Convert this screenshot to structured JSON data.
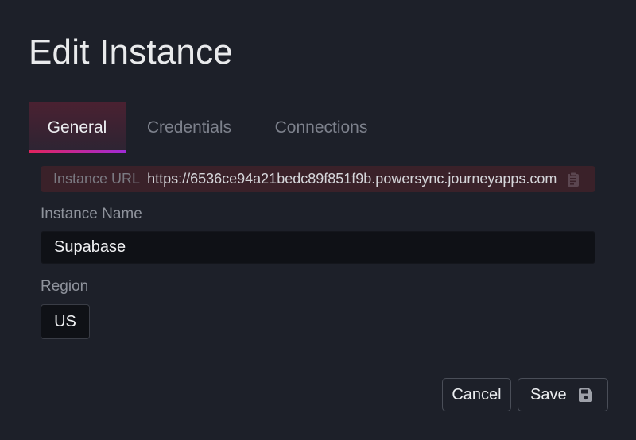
{
  "dialog": {
    "title": "Edit Instance"
  },
  "tabs": [
    {
      "label": "General",
      "active": true
    },
    {
      "label": "Credentials",
      "active": false
    },
    {
      "label": "Connections",
      "active": false
    }
  ],
  "instance_url": {
    "label": "Instance URL",
    "value": "https://6536ce94a21bedc89f851f9b.powersync.journeyapps.com",
    "icon": "clipboard-icon"
  },
  "instance_name": {
    "label": "Instance Name",
    "value": "Supabase"
  },
  "region": {
    "label": "Region",
    "value": "US"
  },
  "actions": {
    "cancel_label": "Cancel",
    "save_label": "Save",
    "save_icon": "floppy-disk-icon"
  },
  "colors": {
    "background": "#1d2029",
    "accent_start": "#e1245c",
    "accent_end": "#a02bd6",
    "url_row_bg": "#3a2129",
    "input_bg": "#0f1116"
  }
}
